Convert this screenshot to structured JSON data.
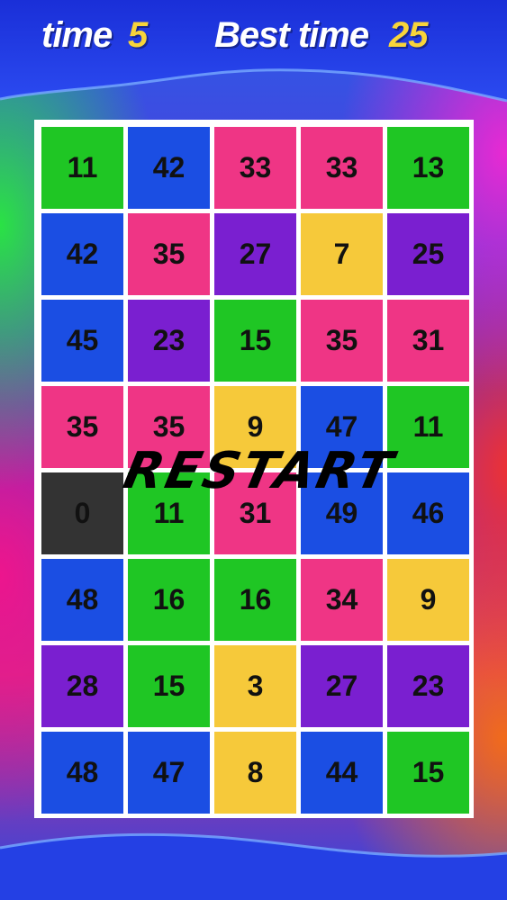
{
  "hud": {
    "time_label": "time",
    "time_value": "5",
    "best_label": "Best time",
    "best_value": "25"
  },
  "restart_label": "RESTART",
  "colors": {
    "green": "#1fc624",
    "blue": "#1b4ee3",
    "pink": "#ef3585",
    "purple": "#7a1fd0",
    "yellow": "#f6c93a",
    "dark": "#333333"
  },
  "grid": [
    [
      {
        "n": "11",
        "c": "green"
      },
      {
        "n": "42",
        "c": "blue"
      },
      {
        "n": "33",
        "c": "pink"
      },
      {
        "n": "33",
        "c": "pink"
      },
      {
        "n": "13",
        "c": "green"
      }
    ],
    [
      {
        "n": "42",
        "c": "blue"
      },
      {
        "n": "35",
        "c": "pink"
      },
      {
        "n": "27",
        "c": "purple"
      },
      {
        "n": "7",
        "c": "yellow"
      },
      {
        "n": "25",
        "c": "purple"
      }
    ],
    [
      {
        "n": "45",
        "c": "blue"
      },
      {
        "n": "23",
        "c": "purple"
      },
      {
        "n": "15",
        "c": "green"
      },
      {
        "n": "35",
        "c": "pink"
      },
      {
        "n": "31",
        "c": "pink"
      }
    ],
    [
      {
        "n": "35",
        "c": "pink"
      },
      {
        "n": "35",
        "c": "pink"
      },
      {
        "n": "9",
        "c": "yellow"
      },
      {
        "n": "47",
        "c": "blue"
      },
      {
        "n": "11",
        "c": "green"
      }
    ],
    [
      {
        "n": "0",
        "c": "dark"
      },
      {
        "n": "11",
        "c": "green"
      },
      {
        "n": "31",
        "c": "pink"
      },
      {
        "n": "49",
        "c": "blue"
      },
      {
        "n": "46",
        "c": "blue"
      }
    ],
    [
      {
        "n": "48",
        "c": "blue"
      },
      {
        "n": "16",
        "c": "green"
      },
      {
        "n": "16",
        "c": "green"
      },
      {
        "n": "34",
        "c": "pink"
      },
      {
        "n": "9",
        "c": "yellow"
      }
    ],
    [
      {
        "n": "28",
        "c": "purple"
      },
      {
        "n": "15",
        "c": "green"
      },
      {
        "n": "3",
        "c": "yellow"
      },
      {
        "n": "27",
        "c": "purple"
      },
      {
        "n": "23",
        "c": "purple"
      }
    ],
    [
      {
        "n": "48",
        "c": "blue"
      },
      {
        "n": "47",
        "c": "blue"
      },
      {
        "n": "8",
        "c": "yellow"
      },
      {
        "n": "44",
        "c": "blue"
      },
      {
        "n": "15",
        "c": "green"
      }
    ]
  ]
}
